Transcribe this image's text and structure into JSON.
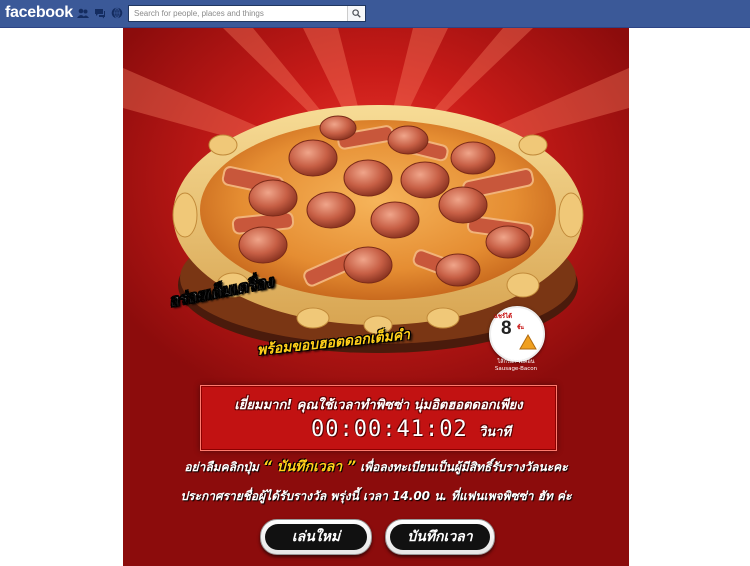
{
  "topbar": {
    "logo": "facebook",
    "search_placeholder": "Search for people, places and things",
    "icons": [
      "friend-requests-icon",
      "messages-icon",
      "notifications-icon",
      "search-icon"
    ]
  },
  "promo": {
    "tagline_1": "อร่อยเต็มเครื่อง",
    "tagline_2a": "พร้อมขอบฮอตดอกเต็มคำ",
    "badge": {
      "top": "แชร์ได้",
      "number": "8",
      "unit": "ชิ้น",
      "caption_th": "ไส้กรอก-เบคอน",
      "caption_en": "Sausage-Bacon"
    },
    "timer": {
      "message": "เยี่ยมมาก! คุณใช้เวลาทำพิซซ่า นุ่มอิตฮอตดอกเพียง",
      "time": "00:00:41:02",
      "unit": "วินาที"
    },
    "instruction_1_pre": "อย่าลืมคลิกปุ่ม",
    "instruction_1_hl": "“ บันทึกเวลา ”",
    "instruction_1_post": "เพื่อลงทะเบียนเป็นผู้มีสิทธิ์รับรางวัลนะคะ",
    "instruction_2": "ประกาศรายชื่อผู้ได้รับรางวัล พรุ่งนี้ เวลา 14.00 น. ที่แฟนเพจพิซซ่า ฮัท ค่ะ",
    "buttons": {
      "replay": "เล่นใหม่",
      "save": "บันทึกเวลา"
    },
    "colors": {
      "background_red": "#c81b18",
      "highlight_yellow": "#ffcf1a",
      "facebook_blue": "#3b5998"
    }
  }
}
